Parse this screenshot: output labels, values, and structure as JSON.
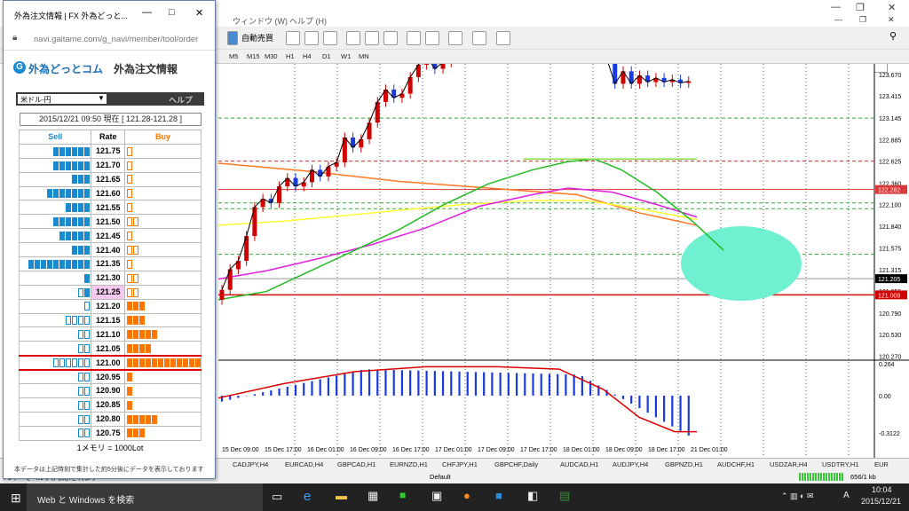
{
  "mt4": {
    "menu": [
      "ウィンドウ (W)",
      "ヘルプ (H)"
    ],
    "toolbar": {
      "auto_trade": "自動売買"
    },
    "timeframes": [
      "M5",
      "M15",
      "M30",
      "H1",
      "H4",
      "D1",
      "W1",
      "MN"
    ],
    "price_axis": [
      "123.670",
      "123.415",
      "123.145",
      "122.885",
      "122.625",
      "122.360",
      "122.100",
      "121.840",
      "121.575",
      "121.315",
      "121.055",
      "120.790",
      "120.530",
      "120.270"
    ],
    "price_tags": [
      {
        "label": "122.282",
        "color": "#d83a3a"
      },
      {
        "label": "121.205",
        "color": "#000000"
      },
      {
        "label": "121.009",
        "color": "#d00000"
      }
    ],
    "osc_axis": [
      "0.264",
      "0.00",
      "-0.3122"
    ],
    "time_axis": [
      "15 Dec 09:00",
      "15 Dec 17:00",
      "16 Dec 01:00",
      "16 Dec 09:00",
      "16 Dec 17:00",
      "17 Dec 01:00",
      "17 Dec 09:00",
      "17 Dec 17:00",
      "18 Dec 01:00",
      "18 Dec 09:00",
      "18 Dec 17:00",
      "21 Dec 01:00"
    ],
    "tabs": [
      "CADJPY,H4",
      "EURCAD,H4",
      "GBPCAD,H1",
      "EURNZD,H1",
      "CHFJPY,H1",
      "GBPCHF,Daily",
      "AUDCAD,H1",
      "AUDJPY,H4",
      "GBPNZD,H1",
      "AUDCHF,H1",
      "USDZAR,H4",
      "USDTRY,H1",
      "EUR"
    ],
    "status": {
      "left": "F1キーでヘルプが表示されます",
      "mid": "Default",
      "right": "656/1 kb"
    },
    "colors": {
      "bull": "#d00000",
      "bear": "#1a3adf",
      "highlight": "#6ff0d0",
      "green": "#22bb22",
      "magenta": "#e020e0",
      "yellow": "#ffff33",
      "orange": "#ff7722"
    }
  },
  "taskbar": {
    "search": "Web と Windows を検索",
    "time": "10:04",
    "date": "2015/12/21",
    "ime": "A"
  },
  "popup": {
    "title": "外為注文情報 | FX 外為どっと...",
    "url": "navi.gaitame.com/g_navi/member/tool/order",
    "brand": "外為どっとコム",
    "heading": "外為注文情報",
    "pair": "米ドル-円",
    "help": "ヘルプ",
    "datetime": "2015/12/21  09:50 現在 [ 121.28-121.28 ]",
    "headers": {
      "sell": "Sell",
      "rate": "Rate",
      "buy": "Buy"
    },
    "rows": [
      {
        "rate": "121.75",
        "sell": 6,
        "buy": 0,
        "sellOpen": 0,
        "buyOpen": 1
      },
      {
        "rate": "121.70",
        "sell": 6,
        "buy": 0,
        "sellOpen": 0,
        "buyOpen": 1
      },
      {
        "rate": "121.65",
        "sell": 3,
        "buy": 0,
        "sellOpen": 0,
        "buyOpen": 1
      },
      {
        "rate": "121.60",
        "sell": 7,
        "buy": 0,
        "sellOpen": 0,
        "buyOpen": 1
      },
      {
        "rate": "121.55",
        "sell": 4,
        "buy": 0,
        "sellOpen": 0,
        "buyOpen": 1
      },
      {
        "rate": "121.50",
        "sell": 6,
        "buy": 0,
        "sellOpen": 0,
        "buyOpen": 2
      },
      {
        "rate": "121.45",
        "sell": 5,
        "buy": 0,
        "sellOpen": 0,
        "buyOpen": 1
      },
      {
        "rate": "121.40",
        "sell": 3,
        "buy": 0,
        "sellOpen": 0,
        "buyOpen": 2
      },
      {
        "rate": "121.35",
        "sell": 10,
        "buy": 0,
        "sellOpen": 0,
        "buyOpen": 1
      },
      {
        "rate": "121.30",
        "sell": 1,
        "buy": 0,
        "sellOpen": 0,
        "buyOpen": 2
      },
      {
        "rate": "121.25",
        "sell": 1,
        "buy": 0,
        "sellOpen": 1,
        "buyOpen": 2,
        "hl": true
      },
      {
        "rate": "121.20",
        "sell": 0,
        "buy": 3,
        "sellOpen": 1,
        "buyOpen": 0
      },
      {
        "rate": "121.15",
        "sell": 0,
        "buy": 3,
        "sellOpen": 4,
        "buyOpen": 0
      },
      {
        "rate": "121.10",
        "sell": 0,
        "buy": 5,
        "sellOpen": 2,
        "buyOpen": 0
      },
      {
        "rate": "121.05",
        "sell": 0,
        "buy": 4,
        "sellOpen": 2,
        "buyOpen": 0
      },
      {
        "rate": "121.00",
        "sell": 0,
        "buy": 12,
        "sellOpen": 6,
        "buyOpen": 0,
        "strong": true
      },
      {
        "rate": "120.95",
        "sell": 0,
        "buy": 1,
        "sellOpen": 2,
        "buyOpen": 0
      },
      {
        "rate": "120.90",
        "sell": 0,
        "buy": 1,
        "sellOpen": 2,
        "buyOpen": 0
      },
      {
        "rate": "120.85",
        "sell": 0,
        "buy": 1,
        "sellOpen": 2,
        "buyOpen": 0
      },
      {
        "rate": "120.80",
        "sell": 0,
        "buy": 5,
        "sellOpen": 2,
        "buyOpen": 0
      },
      {
        "rate": "120.75",
        "sell": 0,
        "buy": 3,
        "sellOpen": 2,
        "buyOpen": 0
      }
    ],
    "lot": "1メモリ = 1000Lot",
    "note": "本データは上記時刻で集計した約5分後にデータを表示しております"
  }
}
